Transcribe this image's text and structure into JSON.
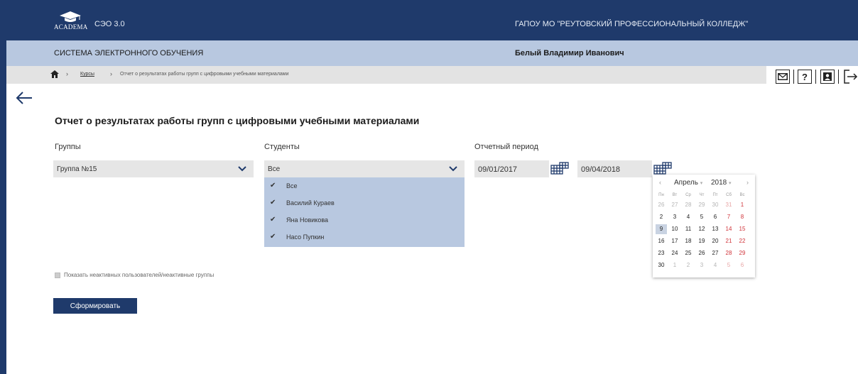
{
  "header": {
    "logo_text": "ACADEMA",
    "app_version": "СЭО 3.0",
    "org_name": "ГАПОУ МО \"РЕУТОВСКИЙ ПРОФЕССИОНАЛЬНЫЙ КОЛЛЕДЖ\"",
    "bg_color": "#1f3a6b"
  },
  "subheader": {
    "system_name": "СИСТЕМА ЭЛЕКТРОННОГО ОБУЧЕНИЯ",
    "user_name": "Белый Владимир Иванович",
    "bg_color": "#b8c8e0"
  },
  "breadcrumb": {
    "home_icon": "home-icon",
    "items": [
      "Курсы",
      "Отчет о результатах работы групп с цифровыми учебными материалами"
    ]
  },
  "toolbar": {
    "icons": [
      "mail-icon",
      "help-icon",
      "profile-icon",
      "logout-icon"
    ],
    "help_glyph": "?"
  },
  "page": {
    "title": "Отчет о результатах работы групп с цифровыми учебными материалами"
  },
  "filters": {
    "groups_label": "Группы",
    "groups_value": "Группа №15",
    "students_label": "Студенты",
    "students_value": "Все",
    "students_options": [
      {
        "label": "Все",
        "checked": true
      },
      {
        "label": "Василий Кураев",
        "checked": true
      },
      {
        "label": "Яна Новикова",
        "checked": true
      },
      {
        "label": "Насо Пупкин",
        "checked": true
      }
    ],
    "period_label": "Отчетный период",
    "date_from": "09/01/2017",
    "date_to": "09/04/2018"
  },
  "calendar": {
    "month": "Апрель",
    "year": "2018",
    "weekdays": [
      "Пн",
      "Вт",
      "Ср",
      "Чт",
      "Пт",
      "Сб",
      "Вс"
    ],
    "weeks": [
      [
        "26",
        "27",
        "28",
        "29",
        "30",
        "31",
        "1"
      ],
      [
        "2",
        "3",
        "4",
        "5",
        "6",
        "7",
        "8"
      ],
      [
        "9",
        "10",
        "11",
        "12",
        "13",
        "14",
        "15"
      ],
      [
        "16",
        "17",
        "18",
        "19",
        "20",
        "21",
        "22"
      ],
      [
        "23",
        "24",
        "25",
        "26",
        "27",
        "28",
        "29"
      ],
      [
        "30",
        "1",
        "2",
        "3",
        "4",
        "5",
        "6"
      ]
    ],
    "selected_day": "9"
  },
  "options": {
    "show_inactive_label": "Показать неактивных пользователей/неактивные группы",
    "show_inactive_checked": false
  },
  "actions": {
    "submit_label": "Сформировать"
  }
}
